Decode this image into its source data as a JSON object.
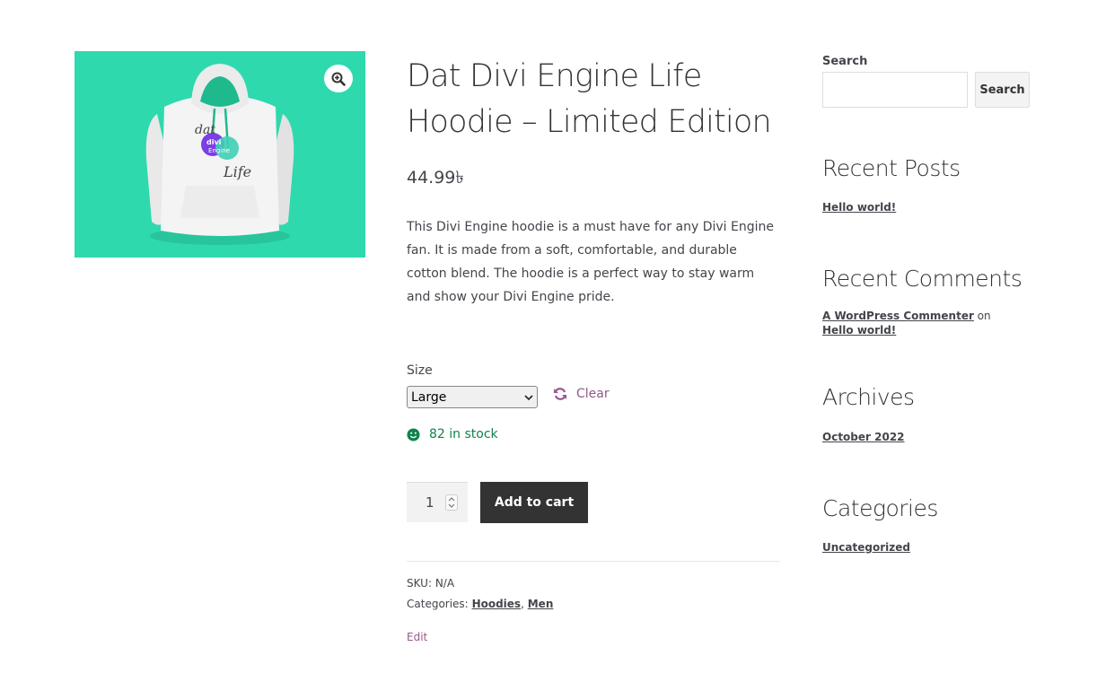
{
  "product": {
    "title": "Dat Divi Engine Life Hoodie – Limited Edition",
    "price": "44.99৳",
    "description": "This Divi Engine hoodie is a must have for any Divi Engine fan. It is made from a soft, comfortable, and durable cotton blend. The hoodie is a perfect way to stay warm and show your Divi Engine pride.",
    "hoodie_print": [
      "dat",
      "divi",
      "Engine",
      "Life"
    ]
  },
  "variation": {
    "size_label": "Size",
    "size_selected": "Large",
    "clear_label": "Clear"
  },
  "stock": {
    "text": "82 in stock"
  },
  "cart": {
    "quantity": "1",
    "add_label": "Add to cart"
  },
  "meta": {
    "sku_label": "SKU:",
    "sku_value": "N/A",
    "categories_label": "Categories:",
    "categories": [
      "Hoodies",
      "Men"
    ],
    "separator": ",",
    "edit_label": "Edit"
  },
  "sidebar": {
    "search_label": "Search",
    "search_button": "Search",
    "recent_posts_title": "Recent Posts",
    "recent_posts": [
      "Hello world!"
    ],
    "recent_comments_title": "Recent Comments",
    "comment_author": "A WordPress Commenter",
    "comment_on": "on",
    "comment_post": "Hello world!",
    "archives_title": "Archives",
    "archives": [
      "October 2022"
    ],
    "categories_title": "Categories",
    "categories": [
      "Uncategorized"
    ]
  },
  "colors": {
    "image_bg": "#2ed9ae",
    "accent": "#96588a",
    "stock_green": "#0f834d",
    "button_dark": "#333333"
  },
  "icons": {
    "zoom": "magnifier-plus-icon",
    "clear": "refresh-icon",
    "stock": "smiley-icon"
  }
}
